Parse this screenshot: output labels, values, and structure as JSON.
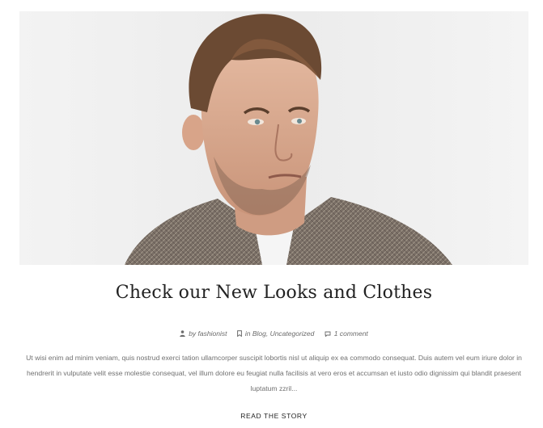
{
  "post": {
    "image_alt": "Man in tweed jacket",
    "title": "Check our New Looks and Clothes",
    "meta": {
      "author": "by fashionist",
      "category_prefix": "in",
      "categories": "Blog, Uncategorized",
      "comments": "1 comment"
    },
    "excerpt": "Ut wisi enim ad minim veniam, quis nostrud exerci tation ullamcorper suscipit lobortis nisl ut aliquip ex ea commodo consequat. Duis autem vel eum iriure dolor in hendrerit in vulputate velit esse molestie consequat, vel illum dolore eu feugiat nulla facilisis at vero eros et accumsan et iusto odio dignissim qui blandit praesent luptatum zzril...",
    "read_more": "READ THE STORY"
  },
  "icons": {
    "author": "user-icon",
    "category": "bookmark-icon",
    "comments": "comment-icon"
  }
}
